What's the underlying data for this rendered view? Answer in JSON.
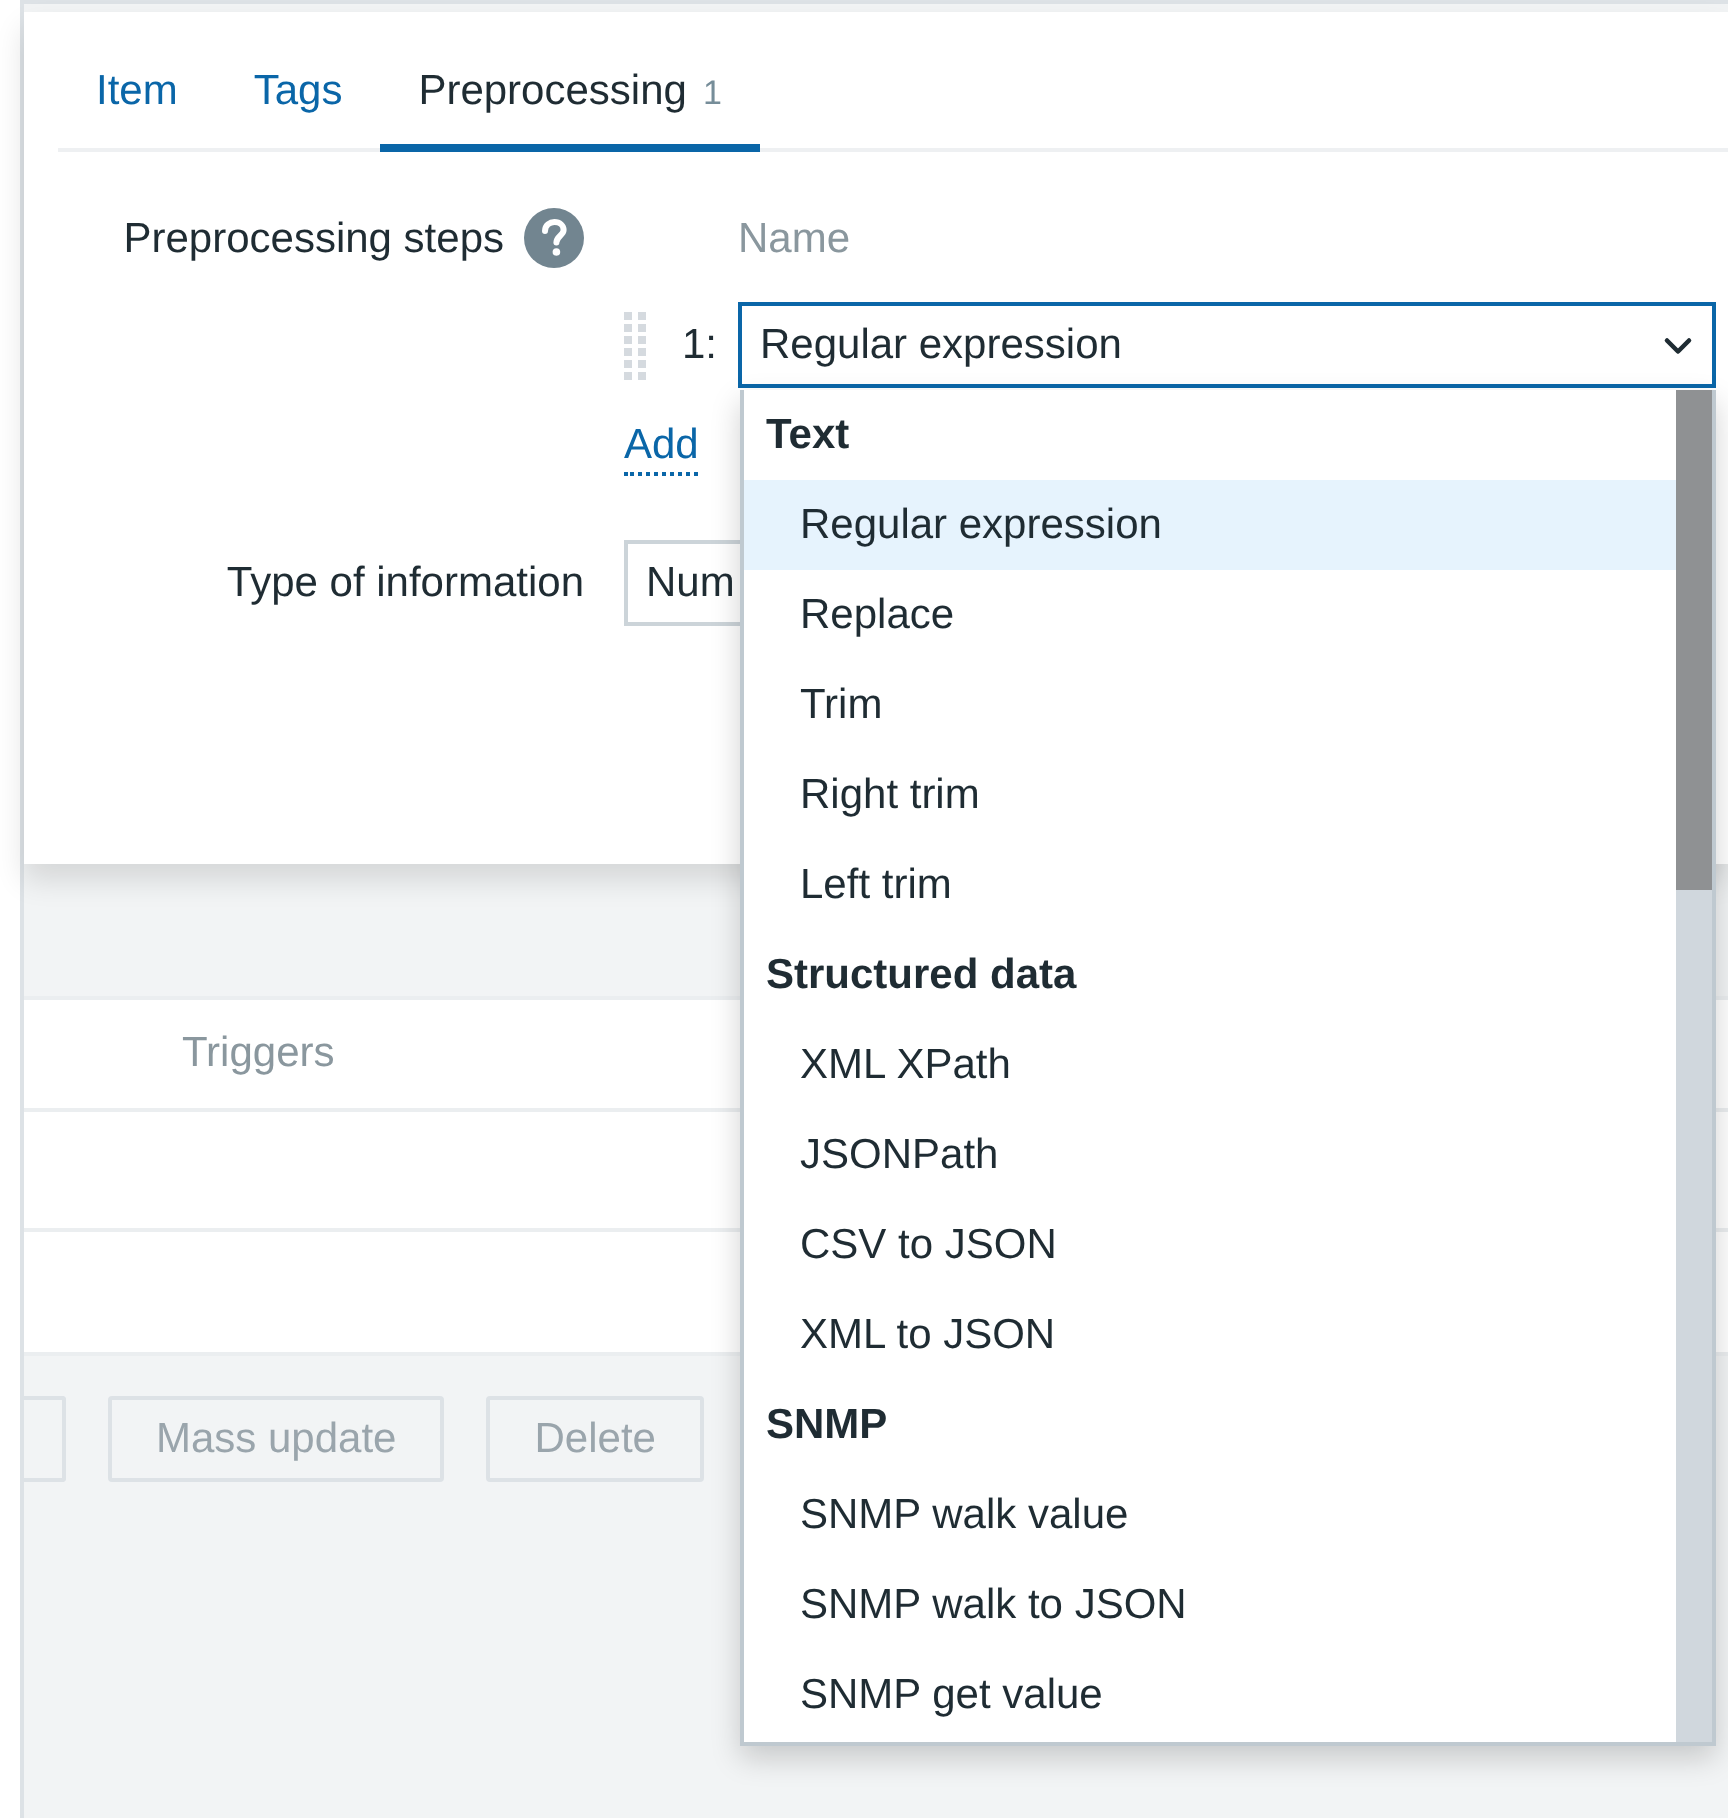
{
  "tabs": [
    {
      "label": "Item",
      "selected": false
    },
    {
      "label": "Tags",
      "selected": false
    },
    {
      "label": "Preprocessing",
      "count": "1",
      "selected": true
    }
  ],
  "form": {
    "steps_label": "Preprocessing steps",
    "name_header": "Name",
    "steps": [
      {
        "number": "1:",
        "value": "Regular expression"
      }
    ],
    "add_link": "Add",
    "type_label": "Type of information",
    "type_value": "Num"
  },
  "table": {
    "columns": [
      "Triggers"
    ]
  },
  "buttons": [
    {
      "label": "Mass update",
      "disabled": true
    },
    {
      "label": "Delete",
      "disabled": true
    }
  ],
  "dropdown": {
    "groups": [
      {
        "label": "Text",
        "options": [
          {
            "label": "Regular expression",
            "selected": true
          },
          {
            "label": "Replace",
            "selected": false
          },
          {
            "label": "Trim",
            "selected": false
          },
          {
            "label": "Right trim",
            "selected": false
          },
          {
            "label": "Left trim",
            "selected": false
          }
        ]
      },
      {
        "label": "Structured data",
        "options": [
          {
            "label": "XML XPath",
            "selected": false
          },
          {
            "label": "JSONPath",
            "selected": false
          },
          {
            "label": "CSV to JSON",
            "selected": false
          },
          {
            "label": "XML to JSON",
            "selected": false
          }
        ]
      },
      {
        "label": "SNMP",
        "options": [
          {
            "label": "SNMP walk value",
            "selected": false
          },
          {
            "label": "SNMP walk to JSON",
            "selected": false
          },
          {
            "label": "SNMP get value",
            "selected": false
          }
        ]
      }
    ]
  }
}
